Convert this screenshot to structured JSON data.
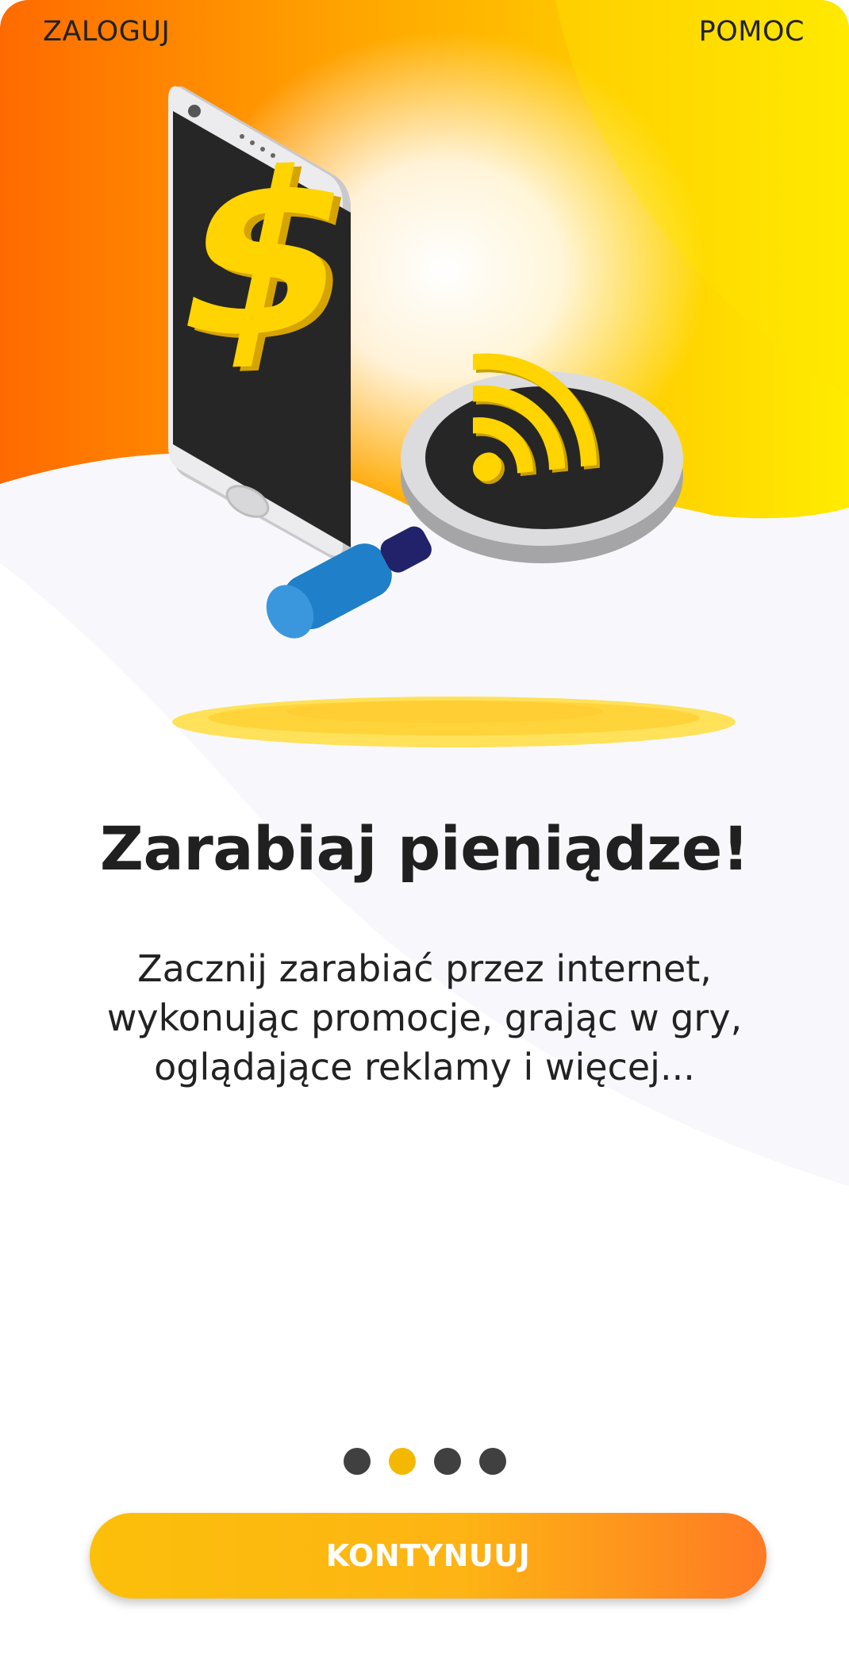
{
  "header": {
    "login_label": "ZALOGUJ",
    "help_label": "POMOC"
  },
  "onboarding": {
    "title": "Zarabiaj pieniądze!",
    "description_lines": [
      "Zacznij zarabiać przez internet,",
      "wykonując promocje, grając w gry,",
      "oglądające reklamy i więcej..."
    ],
    "illustration": {
      "icons": [
        "smartphone-icon",
        "dollar-sign-icon",
        "magnifying-glass-icon",
        "wifi-icon"
      ]
    }
  },
  "pagination": {
    "total": 4,
    "active_index": 1
  },
  "footer": {
    "continue_label": "KONTYNUUJ"
  },
  "colors": {
    "accent_yellow": "#fcbf0a",
    "accent_orange": "#ff7a24",
    "dot_inactive": "#404040",
    "dot_active": "#f5b800",
    "text_dark": "#202020"
  }
}
